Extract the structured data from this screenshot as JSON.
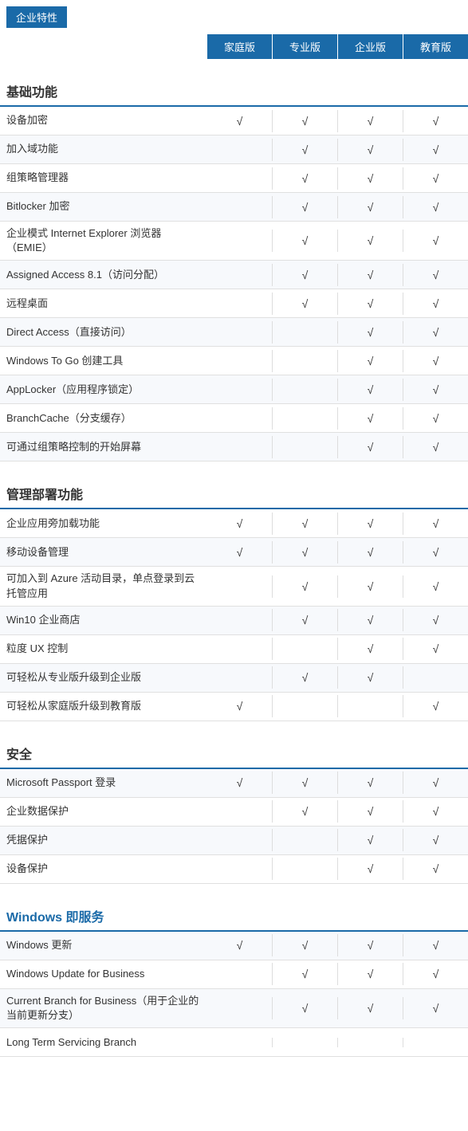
{
  "enterprise_tag": "企业特性",
  "column_headers": {
    "feature": "",
    "home": "家庭版",
    "pro": "专业版",
    "enterprise": "企业版",
    "education": "教育版"
  },
  "sections": [
    {
      "id": "basic",
      "title": "基础功能",
      "blue_text": false,
      "rows": [
        {
          "name": "设备加密",
          "home": "√",
          "pro": "√",
          "enterprise": "√",
          "education": "√"
        },
        {
          "name": "加入域功能",
          "home": "",
          "pro": "√",
          "enterprise": "√",
          "education": "√"
        },
        {
          "name": "组策略管理器",
          "home": "",
          "pro": "√",
          "enterprise": "√",
          "education": "√"
        },
        {
          "name": "Bitlocker 加密",
          "home": "",
          "pro": "√",
          "enterprise": "√",
          "education": "√"
        },
        {
          "name": "企业模式 Internet Explorer 浏览器（EMIE）",
          "home": "",
          "pro": "√",
          "enterprise": "√",
          "education": "√"
        },
        {
          "name": "Assigned Access 8.1（访问分配）",
          "home": "",
          "pro": "√",
          "enterprise": "√",
          "education": "√"
        },
        {
          "name": "远程桌面",
          "home": "",
          "pro": "√",
          "enterprise": "√",
          "education": "√"
        },
        {
          "name": "Direct Access（直接访问）",
          "home": "",
          "pro": "",
          "enterprise": "√",
          "education": "√"
        },
        {
          "name": "Windows To Go 创建工具",
          "home": "",
          "pro": "",
          "enterprise": "√",
          "education": "√"
        },
        {
          "name": "AppLocker（应用程序锁定）",
          "home": "",
          "pro": "",
          "enterprise": "√",
          "education": "√"
        },
        {
          "name": "BranchCache（分支缓存）",
          "home": "",
          "pro": "",
          "enterprise": "√",
          "education": "√"
        },
        {
          "name": "可通过组策略控制的开始屏幕",
          "home": "",
          "pro": "",
          "enterprise": "√",
          "education": "√"
        }
      ]
    },
    {
      "id": "management",
      "title": "管理部署功能",
      "blue_text": false,
      "rows": [
        {
          "name": "企业应用旁加载功能",
          "home": "√",
          "pro": "√",
          "enterprise": "√",
          "education": "√"
        },
        {
          "name": "移动设备管理",
          "home": "√",
          "pro": "√",
          "enterprise": "√",
          "education": "√"
        },
        {
          "name": "可加入到 Azure 活动目录，单点登录到云托管应用",
          "home": "",
          "pro": "√",
          "enterprise": "√",
          "education": "√"
        },
        {
          "name": "Win10 企业商店",
          "home": "",
          "pro": "√",
          "enterprise": "√",
          "education": "√"
        },
        {
          "name": "粒度 UX 控制",
          "home": "",
          "pro": "",
          "enterprise": "√",
          "education": "√"
        },
        {
          "name": "可轻松从专业版升级到企业版",
          "home": "",
          "pro": "√",
          "enterprise": "√",
          "education": ""
        },
        {
          "name": "可轻松从家庭版升级到教育版",
          "home": "√",
          "pro": "",
          "enterprise": "",
          "education": "√"
        }
      ]
    },
    {
      "id": "security",
      "title": "安全",
      "blue_text": false,
      "rows": [
        {
          "name": "Microsoft Passport 登录",
          "home": "√",
          "pro": "√",
          "enterprise": "√",
          "education": "√"
        },
        {
          "name": "企业数据保护",
          "home": "",
          "pro": "√",
          "enterprise": "√",
          "education": "√"
        },
        {
          "name": "凭据保护",
          "home": "",
          "pro": "",
          "enterprise": "√",
          "education": "√"
        },
        {
          "name": "设备保护",
          "home": "",
          "pro": "",
          "enterprise": "√",
          "education": "√"
        }
      ]
    },
    {
      "id": "windows-service",
      "title": "Windows 即服务",
      "blue_text": true,
      "rows": [
        {
          "name": "Windows 更新",
          "home": "√",
          "pro": "√",
          "enterprise": "√",
          "education": "√"
        },
        {
          "name": "Windows Update for Business",
          "home": "",
          "pro": "√",
          "enterprise": "√",
          "education": "√"
        },
        {
          "name": "Current Branch for Business（用于企业的当前更新分支）",
          "home": "",
          "pro": "√",
          "enterprise": "√",
          "education": "√"
        },
        {
          "name": "Long Term Servicing Branch",
          "home": "",
          "pro": "",
          "enterprise": "",
          "education": ""
        }
      ]
    }
  ]
}
